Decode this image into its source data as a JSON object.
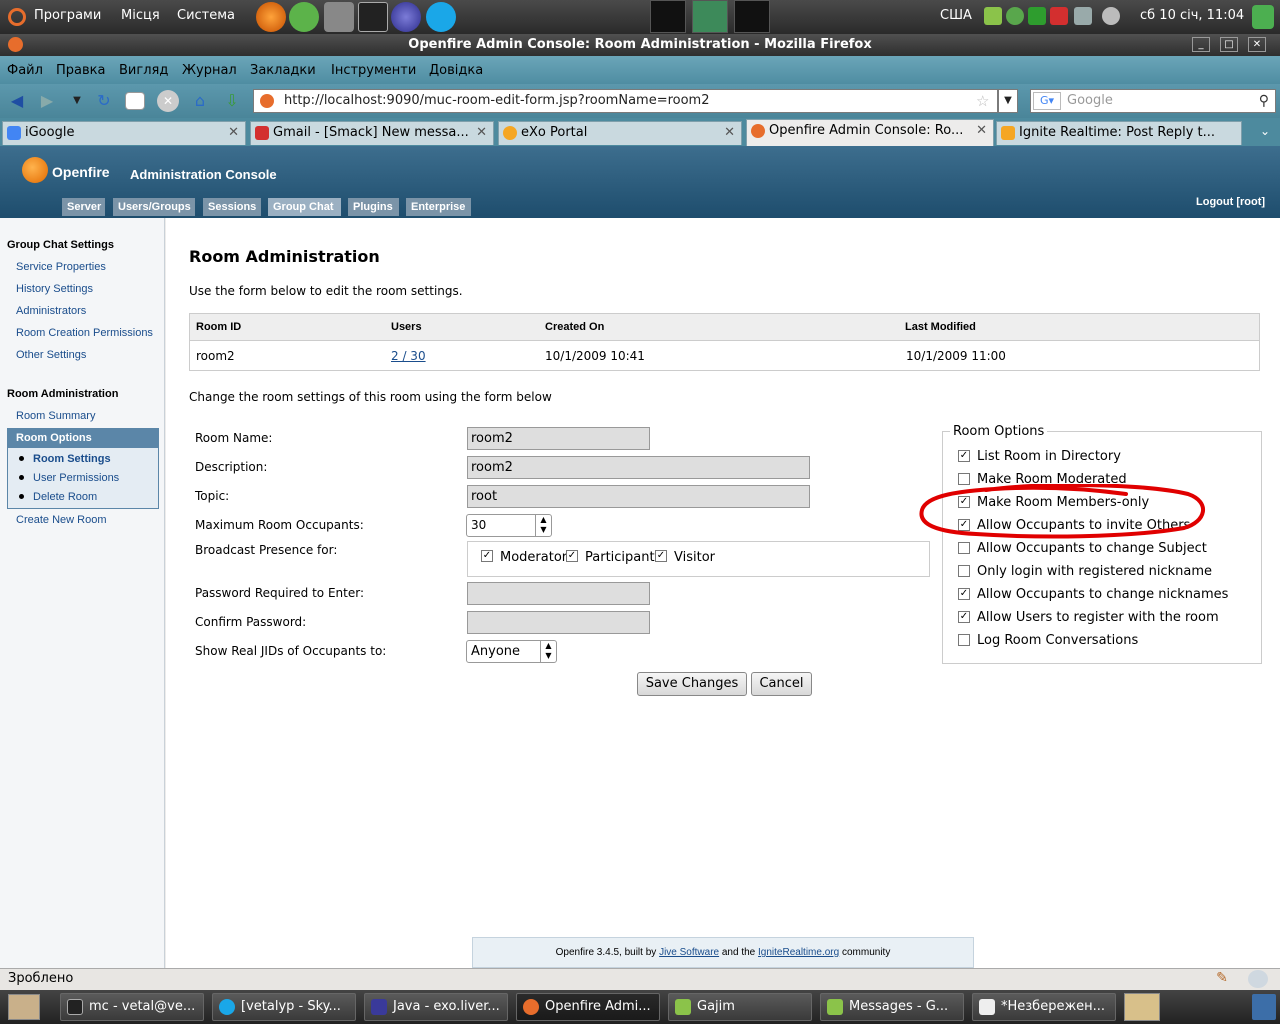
{
  "top_panel": {
    "menus": [
      "Програми",
      "Місця",
      "Система"
    ],
    "keyboard": "США",
    "clock": "сб 10 січ, 11:04"
  },
  "window": {
    "title": "Openfire Admin Console: Room Administration - Mozilla Firefox"
  },
  "firefox_menu": [
    "Файл",
    "Правка",
    "Вигляд",
    "Журнал",
    "Закладки",
    "Інструменти",
    "Довідка"
  ],
  "urlbar": {
    "url": "http://localhost:9090/muc-room-edit-form.jsp?roomName=room2"
  },
  "searchbar": {
    "placeholder": "Google"
  },
  "tabs": [
    {
      "label": "iGoogle"
    },
    {
      "label": "Gmail - [Smack] New messa..."
    },
    {
      "label": "eXo Portal"
    },
    {
      "label": "Openfire Admin Console: Ro..."
    },
    {
      "label": "Ignite Realtime: Post Reply t..."
    }
  ],
  "openfire": {
    "logo": "Openfire",
    "subtitle": "Administration Console",
    "nav": [
      "Server",
      "Users/Groups",
      "Sessions",
      "Group Chat",
      "Plugins",
      "Enterprise"
    ],
    "logout": "Logout [root]"
  },
  "sidebar": {
    "section1": "Group Chat Settings",
    "links1": [
      "Service Properties",
      "History Settings",
      "Administrators",
      "Room Creation Permissions",
      "Other Settings"
    ],
    "section2": "Room Administration",
    "room_summary": "Room Summary",
    "room_options": "Room Options",
    "sub": [
      "Room Settings",
      "User Permissions",
      "Delete Room"
    ],
    "create": "Create New Room"
  },
  "page": {
    "title": "Room Administration",
    "intro": "Use the form below to edit the room settings.",
    "table_headers": [
      "Room ID",
      "Users",
      "Created On",
      "Last Modified"
    ],
    "row": {
      "room_id": "room2",
      "users": "2 / 30",
      "created": "10/1/2009 10:41",
      "modified": "10/1/2009 11:00"
    },
    "change_text": "Change the room settings of this room using the form below"
  },
  "form": {
    "room_name_label": "Room Name:",
    "room_name": "room2",
    "description_label": "Description:",
    "description": "room2",
    "topic_label": "Topic:",
    "topic": "root",
    "max_label": "Maximum Room Occupants:",
    "max_value": "30",
    "broadcast_label": "Broadcast Presence for:",
    "broadcast": [
      "Moderator",
      "Participant",
      "Visitor"
    ],
    "password_label": "Password Required to Enter:",
    "confirm_label": "Confirm Password:",
    "jids_label": "Show Real JIDs of Occupants to:",
    "jids_value": "Anyone",
    "save": "Save Changes",
    "cancel": "Cancel"
  },
  "room_options": {
    "legend": "Room Options",
    "items": [
      {
        "label": "List Room in Directory",
        "checked": true
      },
      {
        "label": "Make Room Moderated",
        "checked": false
      },
      {
        "label": "Make Room Members-only",
        "checked": true
      },
      {
        "label": "Allow Occupants to invite Others",
        "checked": true
      },
      {
        "label": "Allow Occupants to change Subject",
        "checked": false
      },
      {
        "label": "Only login with registered nickname",
        "checked": false
      },
      {
        "label": "Allow Occupants to change nicknames",
        "checked": true
      },
      {
        "label": "Allow Users to register with the room",
        "checked": true
      },
      {
        "label": "Log Room Conversations",
        "checked": false
      }
    ]
  },
  "footer": {
    "text1": "Openfire 3.4.5, built by",
    "link1": "Jive Software",
    "text2": "and the",
    "link2": "IgniteRealtime.org",
    "text3": "community"
  },
  "statusbar": {
    "text": "Зроблено"
  },
  "taskbar": [
    "mc - vetal@ve...",
    "[vetalyp - Sky...",
    "Java - exo.liver...",
    "Openfire Admi...",
    "Gajim",
    "Messages - G...",
    "*Незбережен..."
  ],
  "colors": {
    "annotation": "#e00000",
    "openfire_header": "#1e4d6d",
    "link": "#1a4d8c"
  }
}
